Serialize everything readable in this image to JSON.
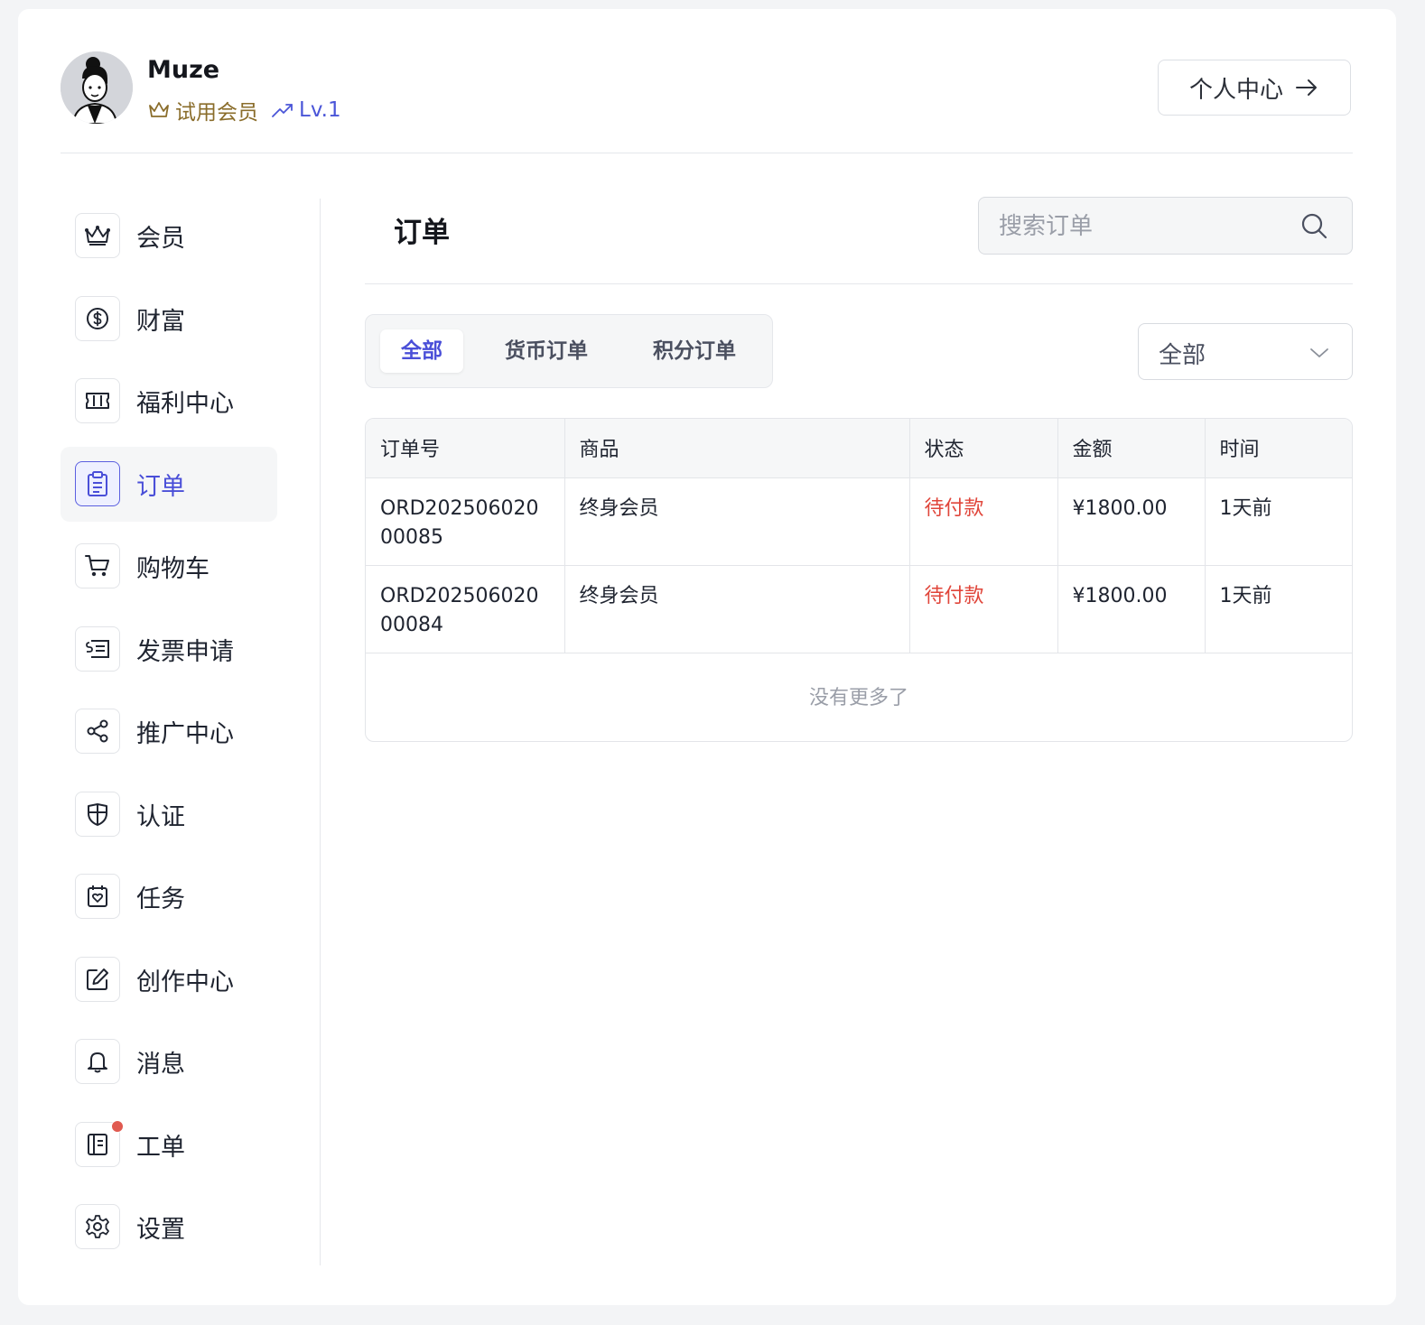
{
  "user": {
    "name": "Muze",
    "member_label": "试用会员",
    "level_label": "Lv.1",
    "profile_button": "个人中心"
  },
  "sidebar": {
    "items": [
      {
        "label": "会员",
        "icon": "crown-icon"
      },
      {
        "label": "财富",
        "icon": "dollar-coin-icon"
      },
      {
        "label": "福利中心",
        "icon": "ticket-icon"
      },
      {
        "label": "订单",
        "icon": "clipboard-icon",
        "active": true
      },
      {
        "label": "购物车",
        "icon": "cart-icon"
      },
      {
        "label": "发票申请",
        "icon": "invoice-icon"
      },
      {
        "label": "推广中心",
        "icon": "share-icon"
      },
      {
        "label": "认证",
        "icon": "shield-icon"
      },
      {
        "label": "任务",
        "icon": "calendar-heart-icon"
      },
      {
        "label": "创作中心",
        "icon": "edit-icon"
      },
      {
        "label": "消息",
        "icon": "bell-icon"
      },
      {
        "label": "工单",
        "icon": "notebook-icon",
        "badge_dot": true
      },
      {
        "label": "设置",
        "icon": "gear-icon"
      }
    ]
  },
  "main": {
    "title": "订单",
    "search_placeholder": "搜索订单",
    "tabs": [
      "全部",
      "货币订单",
      "积分订单"
    ],
    "active_tab": "全部",
    "filter_value": "全部",
    "table": {
      "headers": [
        "订单号",
        "商品",
        "状态",
        "金额",
        "时间"
      ],
      "rows": [
        {
          "order_no": "ORD20250602000085",
          "product": "终身会员",
          "status": "待付款",
          "amount": "¥1800.00",
          "time": "1天前"
        },
        {
          "order_no": "ORD20250602000084",
          "product": "终身会员",
          "status": "待付款",
          "amount": "¥1800.00",
          "time": "1天前"
        }
      ],
      "footer": "没有更多了"
    }
  },
  "colors": {
    "accent": "#4a4fd8",
    "member_gold": "#8a6d2b",
    "status_red": "#e0453a",
    "notification_dot": "#e05a50"
  }
}
